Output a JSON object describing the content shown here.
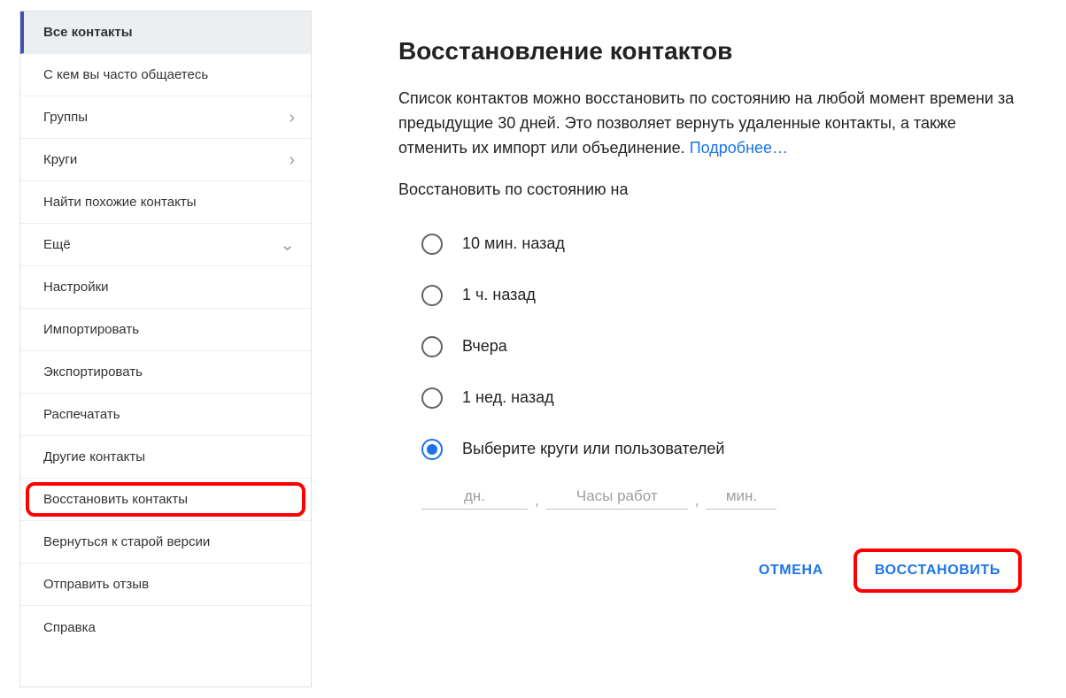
{
  "sidebar": {
    "items": [
      {
        "label": "Все контакты",
        "active": true
      },
      {
        "label": "С кем вы часто общаетесь"
      },
      {
        "label": "Группы",
        "chevron": "right"
      },
      {
        "label": "Круги",
        "chevron": "right"
      },
      {
        "label": "Найти похожие контакты"
      },
      {
        "label": "Ещё",
        "chevron": "down"
      },
      {
        "label": "Настройки"
      },
      {
        "label": "Импортировать"
      },
      {
        "label": "Экспортировать"
      },
      {
        "label": "Распечатать"
      },
      {
        "label": "Другие контакты"
      },
      {
        "label": "Восстановить контакты",
        "highlighted": true
      },
      {
        "label": "Вернуться к старой версии"
      },
      {
        "label": "Отправить отзыв"
      },
      {
        "label": "Справка"
      }
    ]
  },
  "main": {
    "title": "Восстановление контактов",
    "description_text": "Список контактов можно восстановить по состоянию на любой момент времени за предыдущие 30 дней. Это позволяет вернуть удаленные контакты, а также отменить их импорт или объединение. ",
    "description_link": "Подробнее…",
    "subtitle": "Восстановить по состоянию на",
    "radio_options": [
      {
        "label": "10 мин. назад",
        "selected": false
      },
      {
        "label": "1 ч. назад",
        "selected": false
      },
      {
        "label": "Вчера",
        "selected": false
      },
      {
        "label": "1 нед. назад",
        "selected": false
      },
      {
        "label": "Выберите круги или пользователей",
        "selected": true
      }
    ],
    "custom_inputs": {
      "days_placeholder": "дн.",
      "hours_placeholder": "Часы работ",
      "mins_placeholder": "мин.",
      "separator": ","
    },
    "actions": {
      "cancel_label": "ОТМЕНА",
      "restore_label": "ВОССТАНОВИТЬ"
    }
  }
}
